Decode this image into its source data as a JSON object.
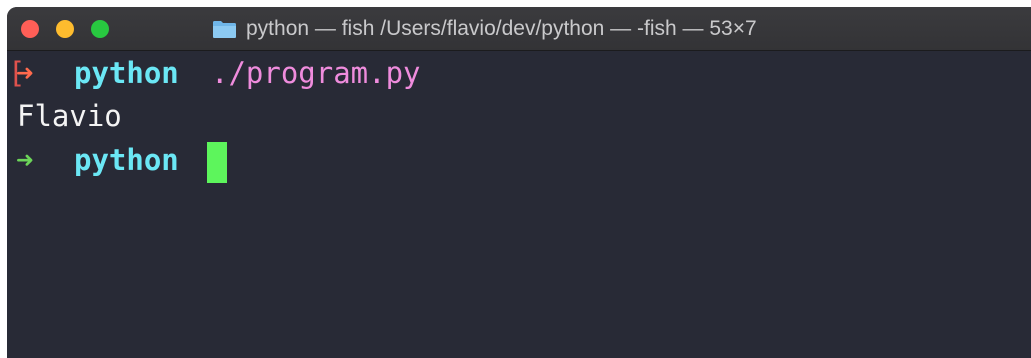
{
  "window": {
    "title": "python — fish /Users/flavio/dev/python — -fish — 53×7",
    "title_icon": "folder-icon",
    "buttons": [
      "close",
      "minimize",
      "maximize"
    ]
  },
  "terminal": {
    "lines": [
      {
        "bracket": "[",
        "prompt_arrow": "➜",
        "arrow_color": "#ff6a4d",
        "cwd": "python",
        "command": "./program.py"
      },
      {
        "output": "Flavio"
      },
      {
        "prompt_arrow": "➜",
        "arrow_color": "#6cd459",
        "cwd": "python",
        "cursor": "block"
      }
    ]
  },
  "colors": {
    "background": "#282a36",
    "cwd": "#6be7f5",
    "command": "#ef8cdd",
    "output": "#f4f4f4",
    "cursor": "#5df55c"
  }
}
